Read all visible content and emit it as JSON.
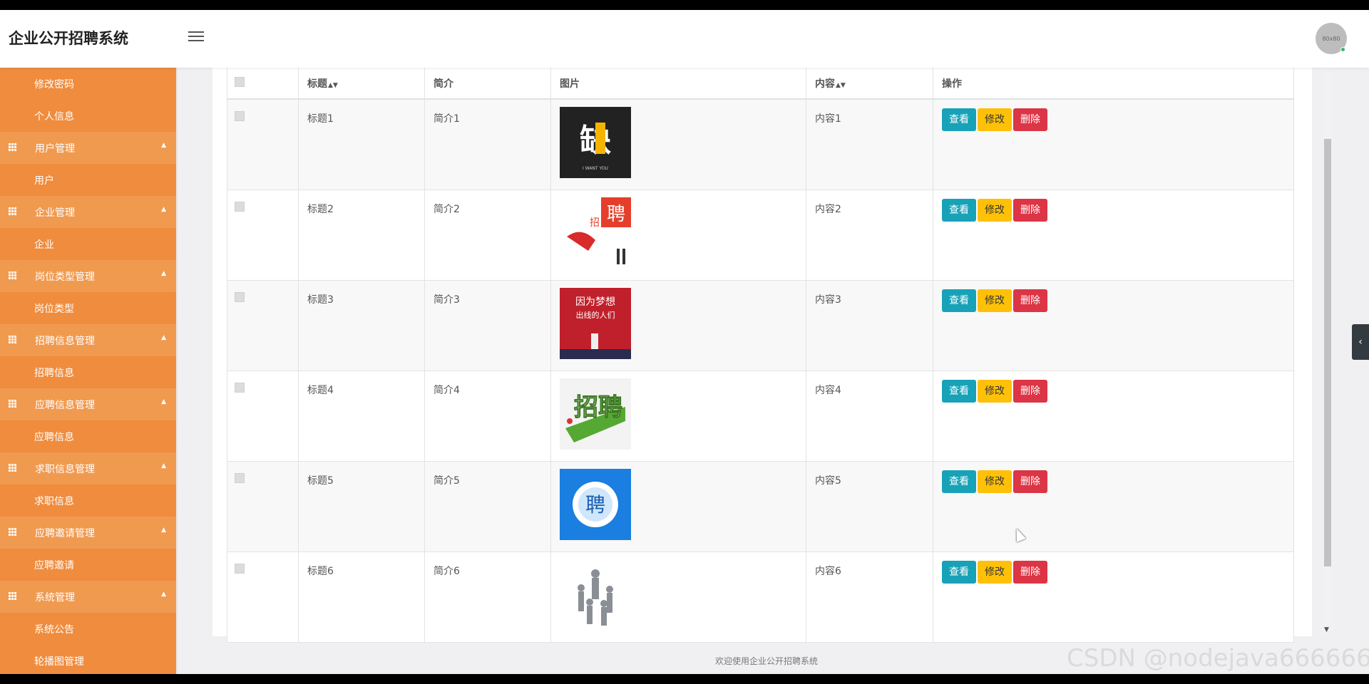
{
  "app_title": "企业公开招聘系统",
  "avatar_text": "80x80",
  "sidebar": [
    {
      "type": "sub",
      "label": "修改密码"
    },
    {
      "type": "sub",
      "label": "个人信息"
    },
    {
      "type": "group",
      "label": "用户管理"
    },
    {
      "type": "sub",
      "label": "用户"
    },
    {
      "type": "group",
      "label": "企业管理"
    },
    {
      "type": "sub",
      "label": "企业"
    },
    {
      "type": "group",
      "label": "岗位类型管理"
    },
    {
      "type": "sub",
      "label": "岗位类型"
    },
    {
      "type": "group",
      "label": "招聘信息管理"
    },
    {
      "type": "sub",
      "label": "招聘信息"
    },
    {
      "type": "group",
      "label": "应聘信息管理"
    },
    {
      "type": "sub",
      "label": "应聘信息"
    },
    {
      "type": "group",
      "label": "求职信息管理"
    },
    {
      "type": "sub",
      "label": "求职信息"
    },
    {
      "type": "group",
      "label": "应聘邀请管理"
    },
    {
      "type": "sub",
      "label": "应聘邀请"
    },
    {
      "type": "group",
      "label": "系统管理"
    },
    {
      "type": "sub",
      "label": "系统公告"
    },
    {
      "type": "sub",
      "label": "轮播图管理"
    }
  ],
  "table": {
    "columns": [
      "",
      "标题",
      "简介",
      "图片",
      "内容",
      "操作"
    ],
    "sortable": [
      false,
      true,
      false,
      false,
      true,
      false
    ],
    "rows": [
      {
        "title": "标题1",
        "intro": "简介1",
        "image": "缺人 I WANT YOU poster",
        "content": "内容1"
      },
      {
        "title": "标题2",
        "intro": "简介2",
        "image": "招聘 poster",
        "content": "内容2"
      },
      {
        "title": "标题3",
        "intro": "简介3",
        "image": "因为梦想 poster",
        "content": "内容3"
      },
      {
        "title": "标题4",
        "intro": "简介4",
        "image": "招聘 3D poster",
        "content": "内容4"
      },
      {
        "title": "标题5",
        "intro": "简介5",
        "image": "聘 blue icon",
        "content": "内容5"
      },
      {
        "title": "标题6",
        "intro": "简介6",
        "image": "team figures",
        "content": "内容6"
      }
    ],
    "actions": {
      "view": "查看",
      "edit": "修改",
      "delete": "删除"
    }
  },
  "footer_text": "欢迎使用企业公开招聘系统",
  "watermark": "CSDN @nodejava666666",
  "colors": {
    "sidebar": "#ef8c3e",
    "sidebar_group": "#f09a50",
    "view_button": "#17a2b8",
    "edit_button": "#ffc107",
    "delete_button": "#dc3545"
  }
}
